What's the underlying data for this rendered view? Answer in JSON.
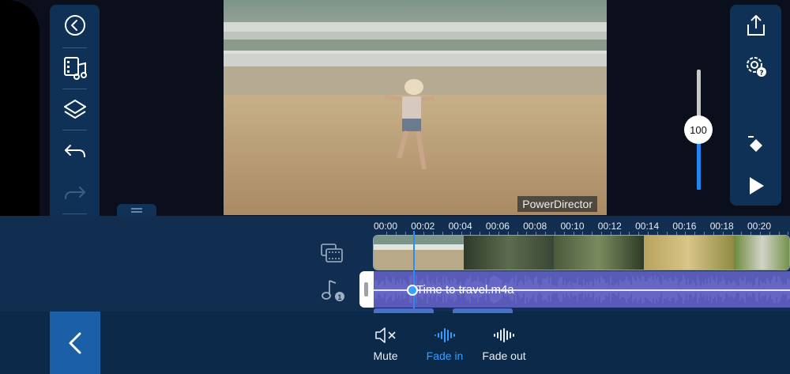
{
  "preview": {
    "watermark": "PowerDirector"
  },
  "volume": {
    "value": "100",
    "level": 0.55
  },
  "ruler": {
    "labels": [
      "00:00",
      "00:02",
      "00:04",
      "00:06",
      "00:08",
      "00:10",
      "00:12",
      "00:14",
      "00:16",
      "00:18",
      "00:20"
    ]
  },
  "audio": {
    "clip_name": "Time to travel.m4a",
    "track_number": "1"
  },
  "bottom_tools": [
    {
      "label": "Mute",
      "icon": "speaker-mute-icon"
    },
    {
      "label": "Fade in",
      "icon": "fade-in-icon"
    },
    {
      "label": "Fade out",
      "icon": "fade-out-icon"
    }
  ],
  "colors": {
    "accent": "#3a9cff",
    "panel": "#0f3155",
    "audio_clip": "#5a5bb8"
  },
  "icons": {
    "left_bar": [
      "back-circle-icon",
      "media-music-icon",
      "layers-icon",
      "undo-icon",
      "redo-icon",
      "trash-icon"
    ],
    "right_bar": [
      "share-export-icon",
      "settings-help-icon",
      "keyframe-icon",
      "play-icon"
    ]
  }
}
